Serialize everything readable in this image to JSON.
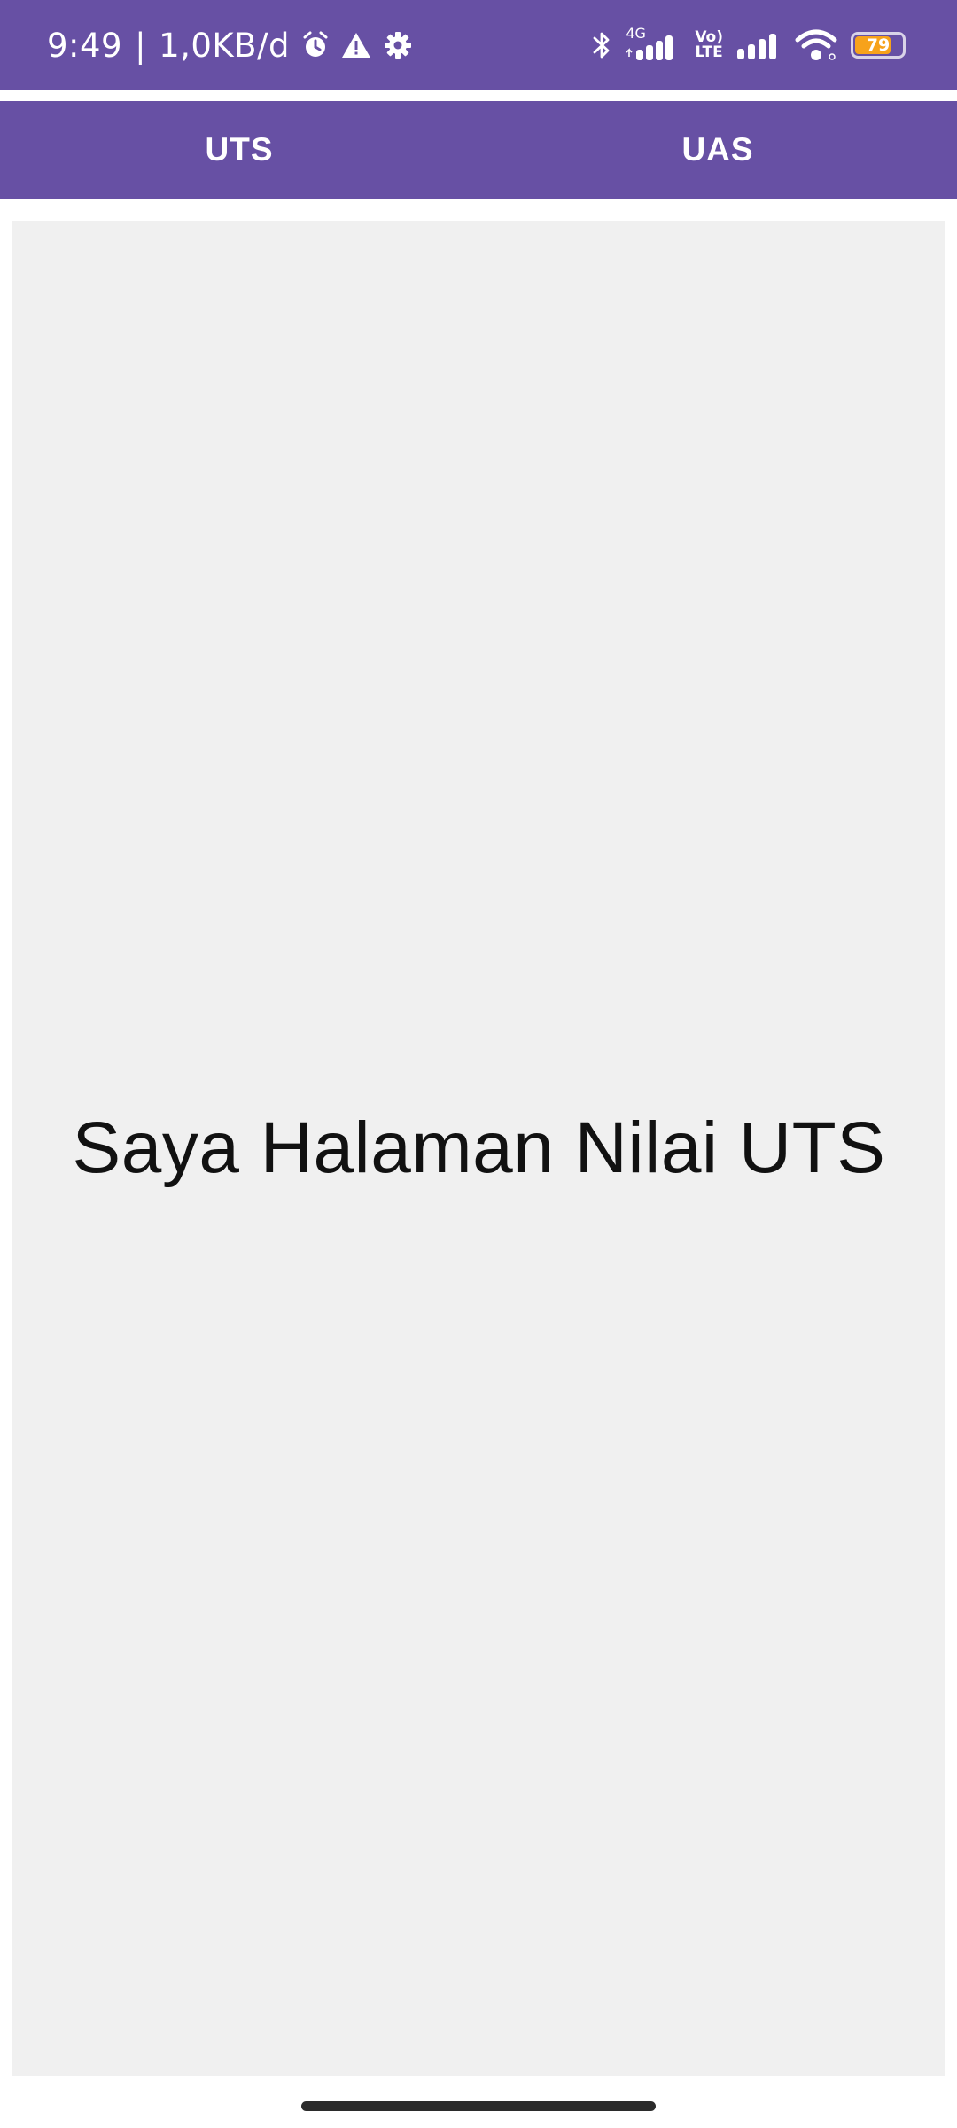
{
  "status_bar": {
    "time": "9:49",
    "separator": "|",
    "data_rate": "1,0KB/d",
    "network_label": "4G",
    "volte_label_top": "Vo)",
    "volte_label_bottom": "LTE",
    "battery_level": "79",
    "battery_color": "#f7a21b",
    "icons": [
      "alarm-icon",
      "warning-icon",
      "gear-icon",
      "bluetooth-icon",
      "signal-4g-icon",
      "volte-icon",
      "signal-icon",
      "wifi-icon",
      "battery-icon"
    ]
  },
  "tabs": [
    {
      "label": "UTS"
    },
    {
      "label": "UAS"
    }
  ],
  "main": {
    "text": "Saya Halaman Nilai UTS"
  },
  "colors": {
    "primary": "#6750a4",
    "content_background": "#f0f0f0"
  }
}
